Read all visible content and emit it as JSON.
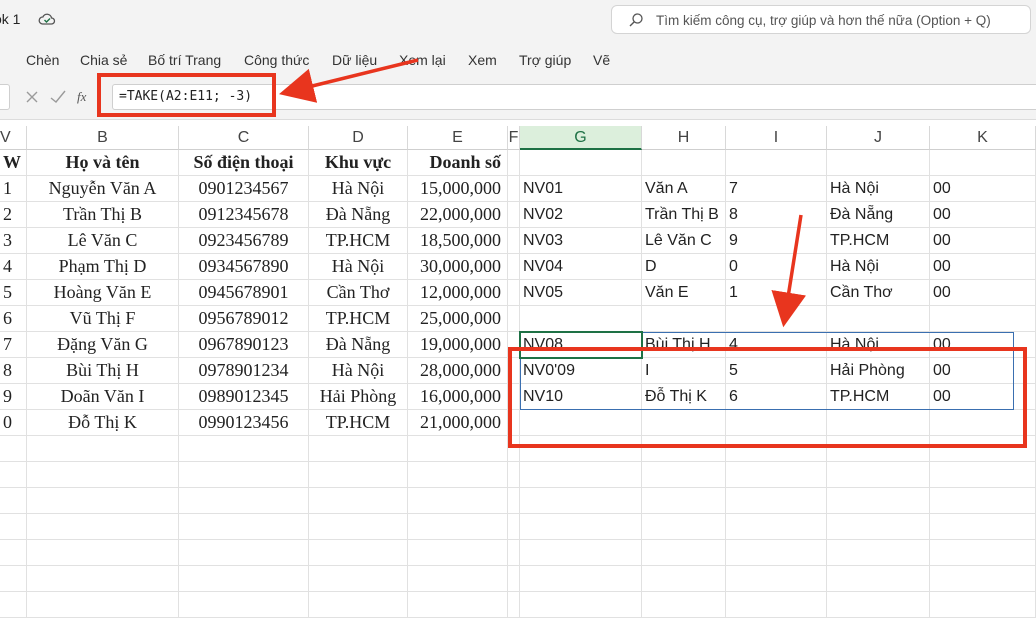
{
  "titlebar": {
    "workbook_name": "ok 1",
    "search_placeholder": "Tìm kiếm công cụ, trợ giúp và hơn thế nữa (Option + Q)"
  },
  "menu": [
    "Chèn",
    "Chia sẻ",
    "Bố trí Trang",
    "Công thức",
    "Dữ liệu",
    "Xem lại",
    "Xem",
    "Trợ giúp",
    "Vẽ"
  ],
  "formula_bar": {
    "formula": "=TAKE(A2:E11; -3)",
    "fx_label": "fx"
  },
  "columns": [
    "V",
    "B",
    "C",
    "D",
    "E",
    "F",
    "G",
    "H",
    "I",
    "J",
    "K"
  ],
  "selected_column": "G",
  "left_table": {
    "headers": [
      "W",
      "Họ và tên",
      "Số điện thoại",
      "Khu vực",
      "Doanh số"
    ],
    "rows": [
      [
        "1",
        "Nguyễn Văn A",
        "0901234567",
        "Hà Nội",
        "15,000,000"
      ],
      [
        "2",
        "Trần Thị B",
        "0912345678",
        "Đà Nẵng",
        "22,000,000"
      ],
      [
        "3",
        "Lê Văn C",
        "0923456789",
        "TP.HCM",
        "18,500,000"
      ],
      [
        "4",
        "Phạm Thị D",
        "0934567890",
        "Hà Nội",
        "30,000,000"
      ],
      [
        "5",
        "Hoàng Văn E",
        "0945678901",
        "Cần Thơ",
        "12,000,000"
      ],
      [
        "6",
        "Vũ Thị F",
        "0956789012",
        "TP.HCM",
        "25,000,000"
      ],
      [
        "7",
        "Đặng Văn G",
        "0967890123",
        "Đà Nẵng",
        "19,000,000"
      ],
      [
        "8",
        "Bùi Thị H",
        "0978901234",
        "Hà Nội",
        "28,000,000"
      ],
      [
        "9",
        "Doãn Văn I",
        "0989012345",
        "Hải Phòng",
        "16,000,000"
      ],
      [
        "0",
        "Đỗ Thị K",
        "0990123456",
        "TP.HCM",
        "21,000,000"
      ]
    ]
  },
  "right_table": {
    "rows": [
      [],
      [
        "NV01",
        "Văn A",
        "7",
        "Hà Nội",
        "00"
      ],
      [
        "NV02",
        "Trần Thị B",
        "8",
        "Đà Nẵng",
        "00"
      ],
      [
        "NV03",
        "Lê Văn C",
        "9",
        "TP.HCM",
        "00"
      ],
      [
        "NV04",
        "D",
        "0",
        "Hà Nội",
        "00"
      ],
      [
        "NV05",
        "Văn E",
        "1",
        "Cần Thơ",
        "00"
      ],
      [],
      [
        "NV08",
        "Bùi Thị H",
        "4",
        "Hà Nội",
        "00"
      ],
      [
        "NV0'09",
        "I",
        "5",
        "Hải Phòng",
        "00"
      ],
      [
        "NV10",
        "Đỗ Thị K",
        "6",
        "TP.HCM",
        "00"
      ]
    ]
  },
  "colors": {
    "annotation_red": "#e8351e",
    "excel_green": "#1e7145"
  }
}
